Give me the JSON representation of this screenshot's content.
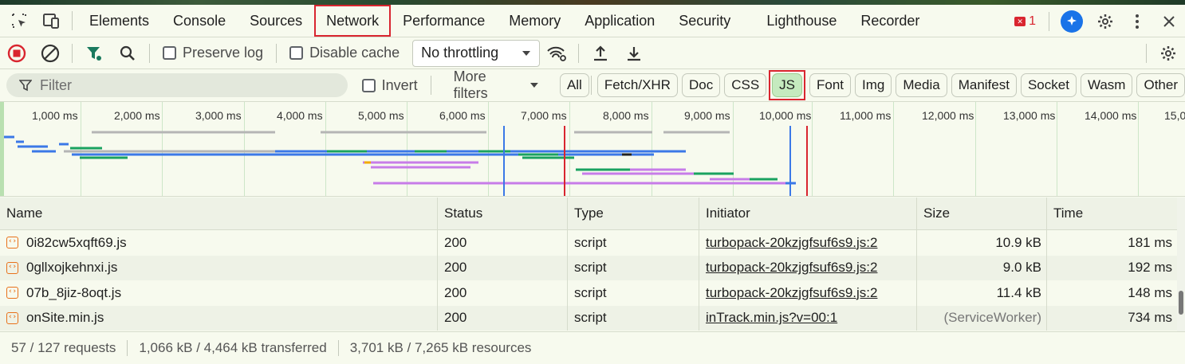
{
  "tabs": [
    "Elements",
    "Console",
    "Sources",
    "Network",
    "Performance",
    "Memory",
    "Application",
    "Security",
    "Lighthouse",
    "Recorder"
  ],
  "active_tab": "Network",
  "error_count": "1",
  "toolbar": {
    "preserve_log": "Preserve log",
    "disable_cache": "Disable cache",
    "throttling": "No throttling"
  },
  "filter": {
    "placeholder": "Filter",
    "invert": "Invert",
    "more_filters": "More filters",
    "chips": [
      "All",
      "Fetch/XHR",
      "Doc",
      "CSS",
      "JS",
      "Font",
      "Img",
      "Media",
      "Manifest",
      "Socket",
      "Wasm",
      "Other"
    ],
    "active_chip": "JS"
  },
  "timeline": {
    "ticks": [
      "1,000 ms",
      "2,000 ms",
      "3,000 ms",
      "4,000 ms",
      "5,000 ms",
      "6,000 ms",
      "7,000 ms",
      "8,000 ms",
      "9,000 ms",
      "10,000 ms",
      "11,000 ms",
      "12,000 ms",
      "13,000 ms",
      "14,000 ms",
      "15,0"
    ]
  },
  "table": {
    "headers": [
      "Name",
      "Status",
      "Type",
      "Initiator",
      "Size",
      "Time"
    ],
    "rows": [
      {
        "name": "0i82cw5xqft69.js",
        "status": "200",
        "type": "script",
        "initiator": "turbopack-20kzjgfsuf6s9.js:2",
        "size": "10.9 kB",
        "time": "181 ms"
      },
      {
        "name": "0gllxojkehnxi.js",
        "status": "200",
        "type": "script",
        "initiator": "turbopack-20kzjgfsuf6s9.js:2",
        "size": "9.0 kB",
        "time": "192 ms"
      },
      {
        "name": "07b_8jiz-8oqt.js",
        "status": "200",
        "type": "script",
        "initiator": "turbopack-20kzjgfsuf6s9.js:2",
        "size": "11.4 kB",
        "time": "148 ms"
      },
      {
        "name": "onSite.min.js",
        "status": "200",
        "type": "script",
        "initiator": "inTrack.min.js?v=00:1",
        "size": "(ServiceWorker)",
        "time": "734 ms"
      }
    ]
  },
  "status": {
    "requests": "57 / 127 requests",
    "transferred": "1,066 kB / 4,464 kB transferred",
    "resources": "3,701 kB / 7,265 kB resources"
  }
}
